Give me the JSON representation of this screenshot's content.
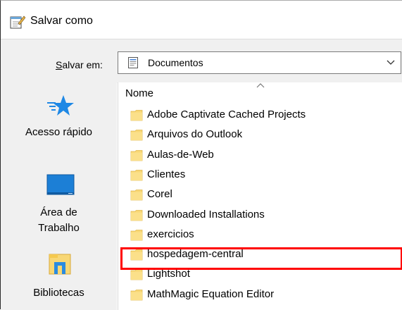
{
  "window": {
    "title": "Salvar como",
    "title_icon": "notepad-save-icon"
  },
  "toolbar": {
    "save_in_label_accel": "S",
    "save_in_label_rest": "alvar em:",
    "location_value": "Documentos",
    "location_icon": "documents-icon"
  },
  "nav": {
    "items": [
      {
        "label": "Acesso rápido",
        "icon": "star-icon"
      },
      {
        "label_line1": "Área de",
        "label_line2": "Trabalho",
        "icon": "desktop-icon"
      },
      {
        "label": "Bibliotecas",
        "icon": "libraries-icon"
      }
    ]
  },
  "filelist": {
    "column_name": "Nome",
    "sort": "ascending",
    "folders": [
      "Adobe Captivate Cached Projects",
      "Arquivos do Outlook",
      "Aulas-de-Web",
      "Clientes",
      "Corel",
      "Downloaded Installations",
      "exercicios",
      "hospedagem-central",
      "Lightshot",
      "MathMagic Equation Editor"
    ],
    "highlighted_folder": "hospedagem-central"
  },
  "colors": {
    "highlight": "#ff0000",
    "folder": "#f8d775",
    "accent": "#1e90ff"
  }
}
